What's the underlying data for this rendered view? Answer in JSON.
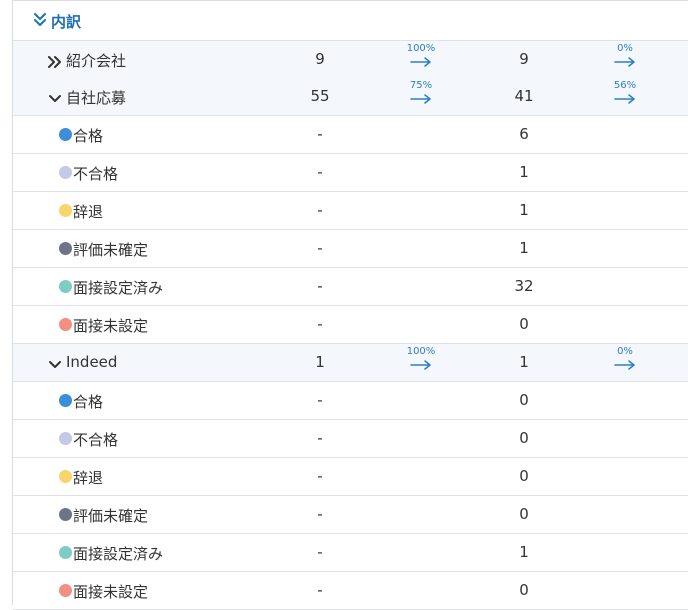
{
  "section": {
    "title": "内訳",
    "icon": "chevron-double-down-icon"
  },
  "colors": {
    "accent": "#1f6fb5",
    "group_row_bg": "#f4f7fc",
    "status_pass": "#3a8fd8",
    "status_fail": "#c5c9e8",
    "status_declined": "#f8d56a",
    "status_unconfirmed": "#6e7389",
    "status_interview_set": "#7ecdc2",
    "status_interview_unset": "#f28f82"
  },
  "groups": [
    {
      "name": "紹介会社",
      "expanded": false,
      "col1": "9",
      "rate1": "100%",
      "col2": "9",
      "rate2": "0%",
      "items": []
    },
    {
      "name": "自社応募",
      "expanded": true,
      "col1": "55",
      "rate1": "75%",
      "col2": "41",
      "rate2": "56%",
      "items": [
        {
          "label": "合格",
          "col1": "-",
          "col2": "6",
          "color": "#3a8fd8"
        },
        {
          "label": "不合格",
          "col1": "-",
          "col2": "1",
          "color": "#c5c9e8"
        },
        {
          "label": "辞退",
          "col1": "-",
          "col2": "1",
          "color": "#f8d56a"
        },
        {
          "label": "評価未確定",
          "col1": "-",
          "col2": "1",
          "color": "#6e7389"
        },
        {
          "label": "面接設定済み",
          "col1": "-",
          "col2": "32",
          "color": "#7ecdc2"
        },
        {
          "label": "面接未設定",
          "col1": "-",
          "col2": "0",
          "color": "#f28f82"
        }
      ]
    },
    {
      "name": "Indeed",
      "expanded": true,
      "col1": "1",
      "rate1": "100%",
      "col2": "1",
      "rate2": "0%",
      "items": [
        {
          "label": "合格",
          "col1": "-",
          "col2": "0",
          "color": "#3a8fd8"
        },
        {
          "label": "不合格",
          "col1": "-",
          "col2": "0",
          "color": "#c5c9e8"
        },
        {
          "label": "辞退",
          "col1": "-",
          "col2": "0",
          "color": "#f8d56a"
        },
        {
          "label": "評価未確定",
          "col1": "-",
          "col2": "0",
          "color": "#6e7389"
        },
        {
          "label": "面接設定済み",
          "col1": "-",
          "col2": "1",
          "color": "#7ecdc2"
        },
        {
          "label": "面接未設定",
          "col1": "-",
          "col2": "0",
          "color": "#f28f82"
        }
      ]
    }
  ]
}
